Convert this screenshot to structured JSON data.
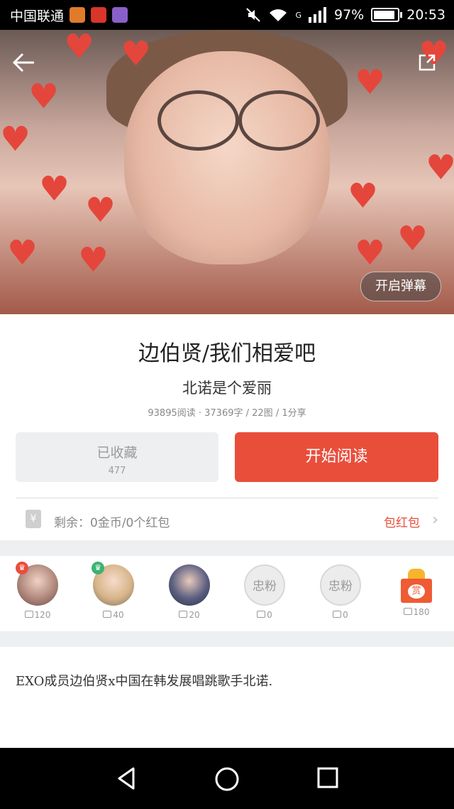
{
  "status_bar": {
    "carrier": "中国联通",
    "battery": "97%",
    "time": "20:53",
    "signal_label": "G"
  },
  "hero": {
    "danmu_button": "开启弹幕"
  },
  "article": {
    "title": "边伯贤/我们相爱吧",
    "author": "北诺是个爱丽",
    "meta": "93895阅读 · 37369字 / 22图 / 1分享"
  },
  "actions": {
    "collect_label": "已收藏",
    "collect_count": "477",
    "read_label": "开始阅读"
  },
  "balance": {
    "text": "剩余：0金币/0个红包",
    "hongbao_label": "包红包"
  },
  "fans": [
    {
      "label": "",
      "coins": "120"
    },
    {
      "label": "",
      "coins": "40"
    },
    {
      "label": "",
      "coins": "20"
    },
    {
      "label": "忠粉",
      "coins": "0"
    },
    {
      "label": "忠粉",
      "coins": "0"
    },
    {
      "label": "赏",
      "coins": "180"
    }
  ],
  "description": "EXO成员边伯贤x中国在韩发展唱跳歌手北诺.",
  "colors": {
    "accent": "#e94e3b",
    "grey_button": "#eeeff1"
  }
}
